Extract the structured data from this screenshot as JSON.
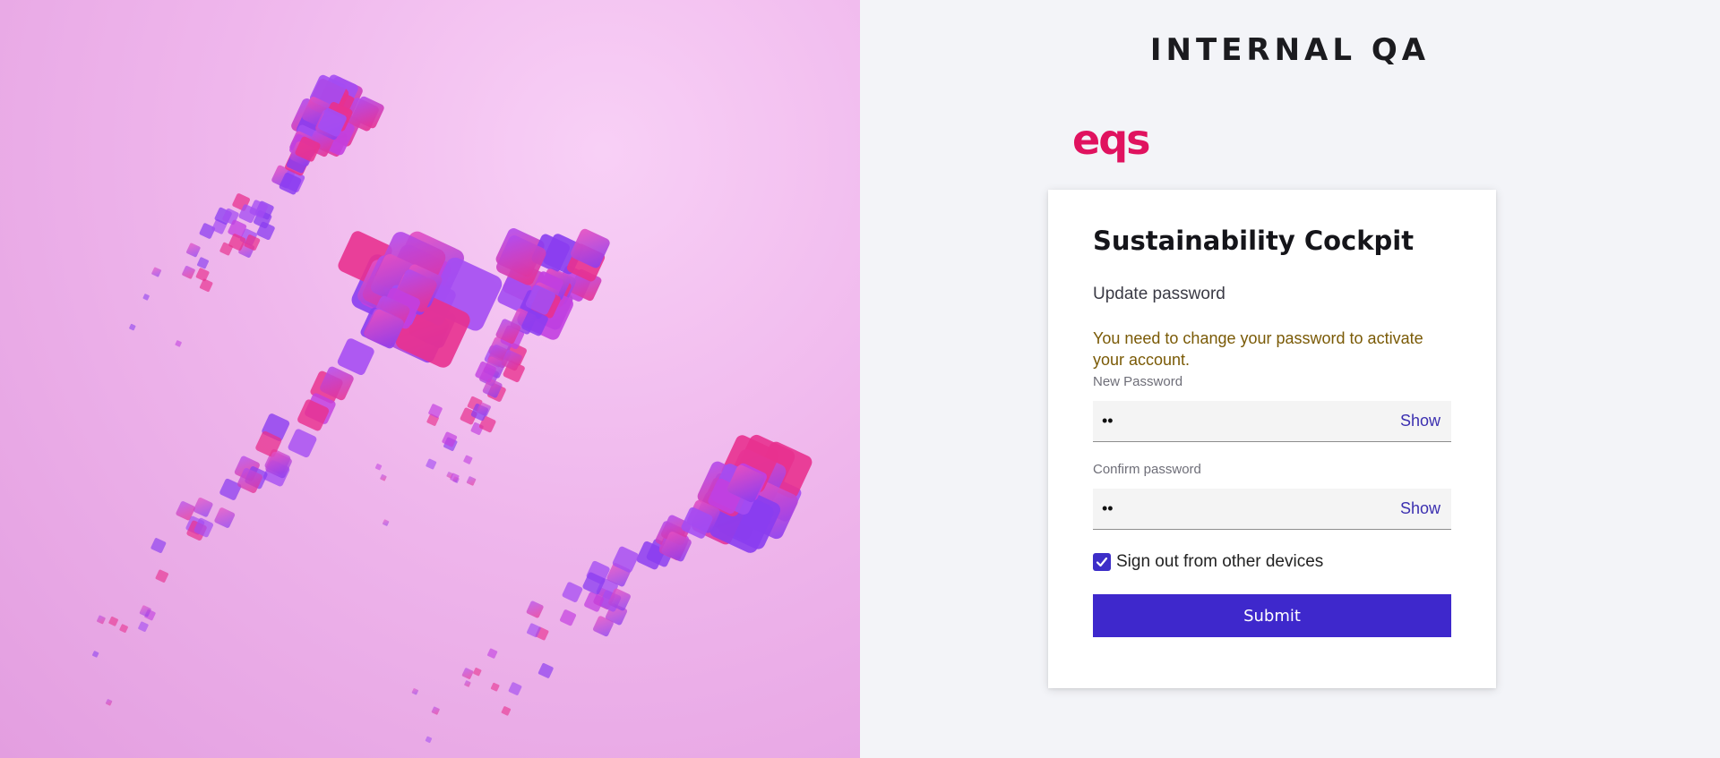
{
  "environment_title": "INTERNAL QA",
  "logo": {
    "text": "eqs",
    "icon": "eqs-logo",
    "color": "#e0125f"
  },
  "card": {
    "app_title": "Sustainability Cockpit",
    "subtitle": "Update password",
    "warning": "You need to change your password to activate your account.",
    "new_password": {
      "label": "New Password",
      "value": "••",
      "show_label": "Show"
    },
    "confirm_password": {
      "label": "Confirm password",
      "value": "••",
      "show_label": "Show"
    },
    "sign_out_checkbox": {
      "label": "Sign out from other devices",
      "checked": true
    },
    "submit_label": "Submit"
  },
  "colors": {
    "accent": "#3e28cc",
    "warning_text": "#7a5a06",
    "hero_pink": "#e39ee0",
    "cube_purple": "#8a3df0",
    "cube_magenta": "#e8318f"
  },
  "hero_image": {
    "icon": "pixel-cubes-illustration"
  }
}
